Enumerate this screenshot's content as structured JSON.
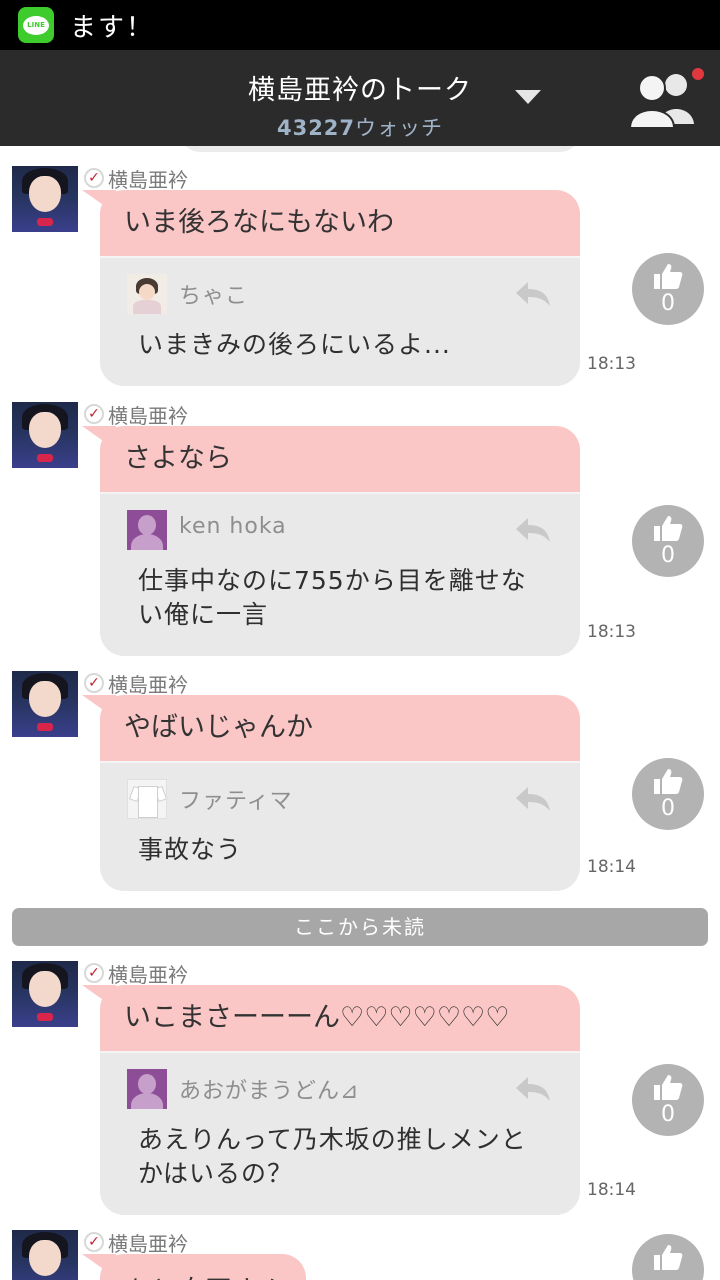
{
  "status_bar": {
    "notification_text": "ます！",
    "app_icon": "line-app-icon",
    "app_icon_label": "LINE"
  },
  "header": {
    "title": "横島亜衿のトーク",
    "watch_count": "43227",
    "watch_label": "ウォッチ",
    "dropdown_icon": "triangle-down-icon",
    "members_icon": "members-icon",
    "notification_dot_color": "#e0383e"
  },
  "messages": [
    {
      "sender": "横島亜衿",
      "text": "いま後ろなにもないわ",
      "reply": {
        "name": "ちゃこ",
        "text": "いまきみの後ろにいるよ..."
      },
      "time": "18:13",
      "likes": "0"
    },
    {
      "sender": "横島亜衿",
      "text": "さよなら",
      "reply": {
        "name": "ken hoka",
        "text": "仕事中なのに755から目を離せない俺に一言"
      },
      "time": "18:13",
      "likes": "0"
    },
    {
      "sender": "横島亜衿",
      "text": "やばいじゃんか",
      "reply": {
        "name": "ファティマ",
        "text": "事故なう"
      },
      "time": "18:14",
      "likes": "0"
    },
    {
      "sender": "横島亜衿",
      "text": "いこまさーーーん♡♡♡♡♡♡♡",
      "reply": {
        "name": "あおがまうどん⊿",
        "text": "あえりんって乃木坂の推しメンとかはいるの？"
      },
      "time": "18:14",
      "likes": "0"
    },
    {
      "sender": "横島亜衿",
      "text": "あと自画さん"
    }
  ],
  "unread_divider": "ここから未読",
  "colors": {
    "post_bubble": "#fbc6c6",
    "reply_bubble": "#e9e9e9",
    "header_bg": "#2b2b2b",
    "like_button": "#b3b3b3",
    "watch_count": "#9fb3c8"
  }
}
